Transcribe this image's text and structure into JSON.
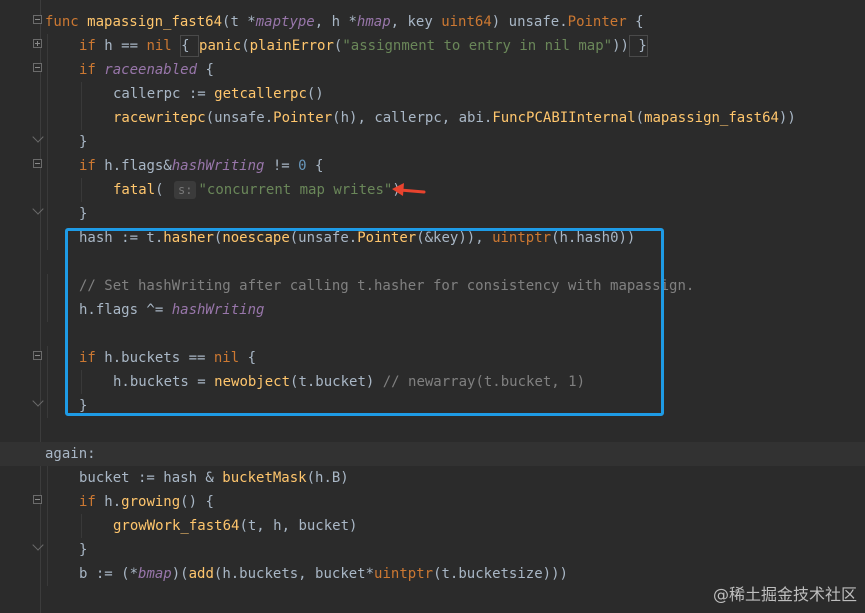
{
  "editor": {
    "lines": [
      {
        "tokens": [
          [
            "kw",
            "func "
          ],
          [
            "fn",
            "mapassign_fast64"
          ],
          [
            "par",
            "(t *"
          ],
          [
            "it",
            "maptype"
          ],
          [
            "par",
            ", h *"
          ],
          [
            "it",
            "hmap"
          ],
          [
            "par",
            ", key "
          ],
          [
            "kw",
            "uint64"
          ],
          [
            "par",
            ") unsafe."
          ],
          [
            "ty",
            "Pointer"
          ],
          [
            "par",
            " {"
          ]
        ]
      },
      {
        "indent": 1,
        "tokens": [
          [
            "kw",
            "if "
          ],
          [
            "par",
            "h == "
          ],
          [
            "kw",
            "nil "
          ],
          [
            "box",
            "{ "
          ],
          [
            "call",
            "panic"
          ],
          [
            "par",
            "("
          ],
          [
            "call",
            "plainError"
          ],
          [
            "par",
            "("
          ],
          [
            "str",
            "\"assignment to entry in nil map\""
          ],
          [
            "par",
            "))"
          ],
          [
            "box",
            " }"
          ]
        ]
      },
      {
        "indent": 1,
        "tokens": [
          [
            "kw",
            "if "
          ],
          [
            "it",
            "raceenabled"
          ],
          [
            "par",
            " {"
          ]
        ]
      },
      {
        "indent": 2,
        "tokens": [
          [
            "par",
            "callerpc := "
          ],
          [
            "call",
            "getcallerpc"
          ],
          [
            "par",
            "()"
          ]
        ]
      },
      {
        "indent": 2,
        "tokens": [
          [
            "call",
            "racewritepc"
          ],
          [
            "par",
            "(unsafe."
          ],
          [
            "call",
            "Pointer"
          ],
          [
            "par",
            "(h), callerpc, abi."
          ],
          [
            "call",
            "FuncPCABIInternal"
          ],
          [
            "par",
            "("
          ],
          [
            "fn",
            "mapassign_fast64"
          ],
          [
            "par",
            "))"
          ]
        ]
      },
      {
        "indent": 1,
        "tokens": [
          [
            "par",
            "}"
          ]
        ]
      },
      {
        "indent": 1,
        "tokens": [
          [
            "kw",
            "if "
          ],
          [
            "par",
            "h.flags&"
          ],
          [
            "it",
            "hashWriting"
          ],
          [
            "par",
            " != "
          ],
          [
            "num",
            "0"
          ],
          [
            "par",
            " {"
          ]
        ]
      },
      {
        "indent": 2,
        "tokens": [
          [
            "call",
            "fatal"
          ],
          [
            "par",
            "( "
          ],
          [
            "hint",
            "s:"
          ],
          [
            "str",
            "\"concurrent map writes\""
          ],
          [
            "par",
            ")"
          ]
        ]
      },
      {
        "indent": 1,
        "tokens": [
          [
            "par",
            "}"
          ]
        ]
      },
      {
        "indent": 1,
        "tokens": [
          [
            "par",
            "hash := t."
          ],
          [
            "call",
            "hasher"
          ],
          [
            "par",
            "("
          ],
          [
            "call",
            "noescape"
          ],
          [
            "par",
            "(unsafe."
          ],
          [
            "call",
            "Pointer"
          ],
          [
            "par",
            "(&key)), "
          ],
          [
            "kw",
            "uintptr"
          ],
          [
            "par",
            "(h.hash0))"
          ]
        ]
      },
      {
        "indent": 0,
        "tokens": []
      },
      {
        "indent": 1,
        "tokens": [
          [
            "cm",
            "// Set hashWriting after calling t.hasher for consistency with mapassign."
          ]
        ]
      },
      {
        "indent": 1,
        "tokens": [
          [
            "par",
            "h.flags ^= "
          ],
          [
            "it",
            "hashWriting"
          ]
        ]
      },
      {
        "indent": 0,
        "tokens": []
      },
      {
        "indent": 1,
        "tokens": [
          [
            "kw",
            "if "
          ],
          [
            "par",
            "h.buckets == "
          ],
          [
            "kw",
            "nil"
          ],
          [
            "par",
            " {"
          ]
        ]
      },
      {
        "indent": 2,
        "tokens": [
          [
            "par",
            "h.buckets = "
          ],
          [
            "call",
            "newobject"
          ],
          [
            "par",
            "(t.bucket) "
          ],
          [
            "cm",
            "// newarray(t.bucket, 1)"
          ]
        ]
      },
      {
        "indent": 1,
        "tokens": [
          [
            "par",
            "}"
          ]
        ]
      },
      {
        "indent": 0,
        "tokens": []
      },
      {
        "indent": 0,
        "hl": true,
        "tokens": [
          [
            "par",
            "again:"
          ]
        ]
      },
      {
        "indent": 1,
        "tokens": [
          [
            "par",
            "bucket := hash & "
          ],
          [
            "call",
            "bucketMask"
          ],
          [
            "par",
            "(h.B)"
          ]
        ]
      },
      {
        "indent": 1,
        "tokens": [
          [
            "kw",
            "if "
          ],
          [
            "par",
            "h."
          ],
          [
            "call",
            "growing"
          ],
          [
            "par",
            "() {"
          ]
        ]
      },
      {
        "indent": 2,
        "tokens": [
          [
            "call",
            "growWork_fast64"
          ],
          [
            "par",
            "(t, h, bucket)"
          ]
        ]
      },
      {
        "indent": 1,
        "tokens": [
          [
            "par",
            "}"
          ]
        ]
      },
      {
        "indent": 1,
        "tokens": [
          [
            "par",
            "b := (*"
          ],
          [
            "it",
            "bmap"
          ],
          [
            "par",
            ")("
          ],
          [
            "call",
            "add"
          ],
          [
            "par",
            "(h.buckets, bucket*"
          ],
          [
            "kw",
            "uintptr"
          ],
          [
            "par",
            "(t.bucketsize)))"
          ]
        ]
      }
    ]
  },
  "watermark": "@稀土掘金技术社区",
  "colors": {
    "selection_box": "#1e9be6",
    "arrow": "#e8432e"
  },
  "icons": {
    "fold": "fold-toggle-icon",
    "arrow": "red-arrow-icon"
  }
}
